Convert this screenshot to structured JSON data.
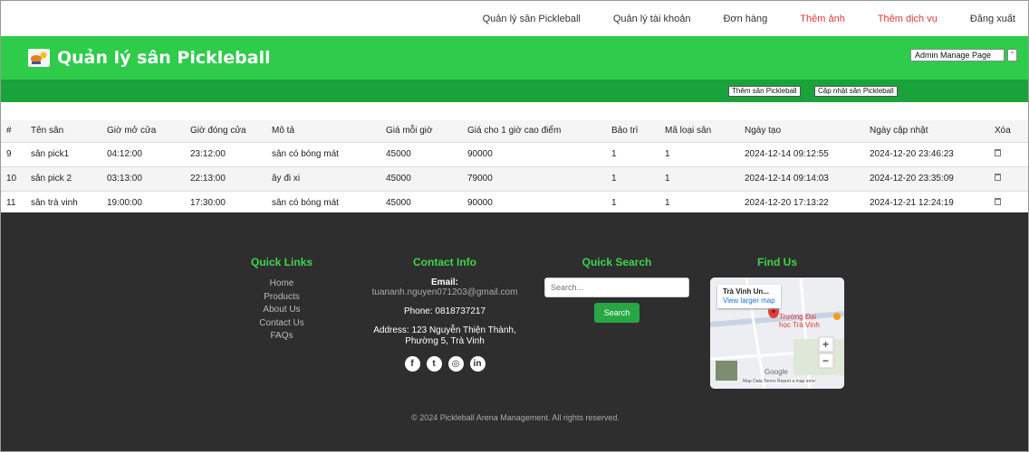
{
  "topnav": {
    "items": [
      {
        "label": "Quản lý sân Pickleball"
      },
      {
        "label": "Quản lý tài khoản"
      },
      {
        "label": "Đơn hàng"
      },
      {
        "label": "Thêm ảnh"
      },
      {
        "label": "Thêm dịch vụ"
      },
      {
        "label": "Đăng xuất"
      }
    ]
  },
  "header": {
    "title": "Quản lý sân Pickleball",
    "admin_select_value": "Admin Manage Page"
  },
  "subbar": {
    "add_label": "Thêm sân Pickleball",
    "update_label": "Cập nhật sân Pickleball"
  },
  "table": {
    "columns": [
      "#",
      "Tên sân",
      "Giờ mở cửa",
      "Giờ đóng cửa",
      "Mô tả",
      "Giá mỗi giờ",
      "Giá cho 1 giờ cao điểm",
      "Bảo trì",
      "Mã loại sân",
      "Ngày tạo",
      "Ngày cập nhật",
      "Xóa"
    ],
    "rows": [
      [
        "9",
        "sân pick1",
        "04:12:00",
        "23:12:00",
        "sân có bóng mát",
        "45000",
        "90000",
        "1",
        "1",
        "2024-12-14 09:12:55",
        "2024-12-20 23:46:23"
      ],
      [
        "10",
        "sân pick 2",
        "03:13:00",
        "22:13:00",
        "ây đi xi",
        "45000",
        "79000",
        "1",
        "1",
        "2024-12-14 09:14:03",
        "2024-12-20 23:35:09"
      ],
      [
        "11",
        "sân trà vinh",
        "19:00:00",
        "17:30:00",
        "sân có bóng mát",
        "45000",
        "90000",
        "1",
        "1",
        "2024-12-20 17:13:22",
        "2024-12-21 12:24:19"
      ]
    ]
  },
  "footer": {
    "quick_links": {
      "heading": "Quick Links",
      "items": [
        "Home",
        "Products",
        "About Us",
        "Contact Us",
        "FAQs"
      ]
    },
    "contact": {
      "heading": "Contact Info",
      "email_label": "Email:",
      "email": "tuananh.nguyen071203@gmail.com",
      "phone": "Phone: 0818737217",
      "address": "Address: 123 Nguyễn Thiện Thành, Phường 5, Trà Vinh"
    },
    "search": {
      "heading": "Quick Search",
      "placeholder": "Search...",
      "button": "Search"
    },
    "find": {
      "heading": "Find Us",
      "map_place": "Trà Vinh Un...",
      "map_link": "View larger map",
      "map_pin_label": "Trường Đại học Trà Vinh",
      "map_footer": "Map Data  Terms  Report a map error",
      "map_brand": "Google"
    },
    "copyright": "© 2024 Pickleball Arena Management. All rights reserved."
  },
  "colors": {
    "header_green": "#2ecc4a",
    "subbar_green": "#1aa33a",
    "footer_bg": "#2e2e2e",
    "accent_red": "#e53935"
  }
}
